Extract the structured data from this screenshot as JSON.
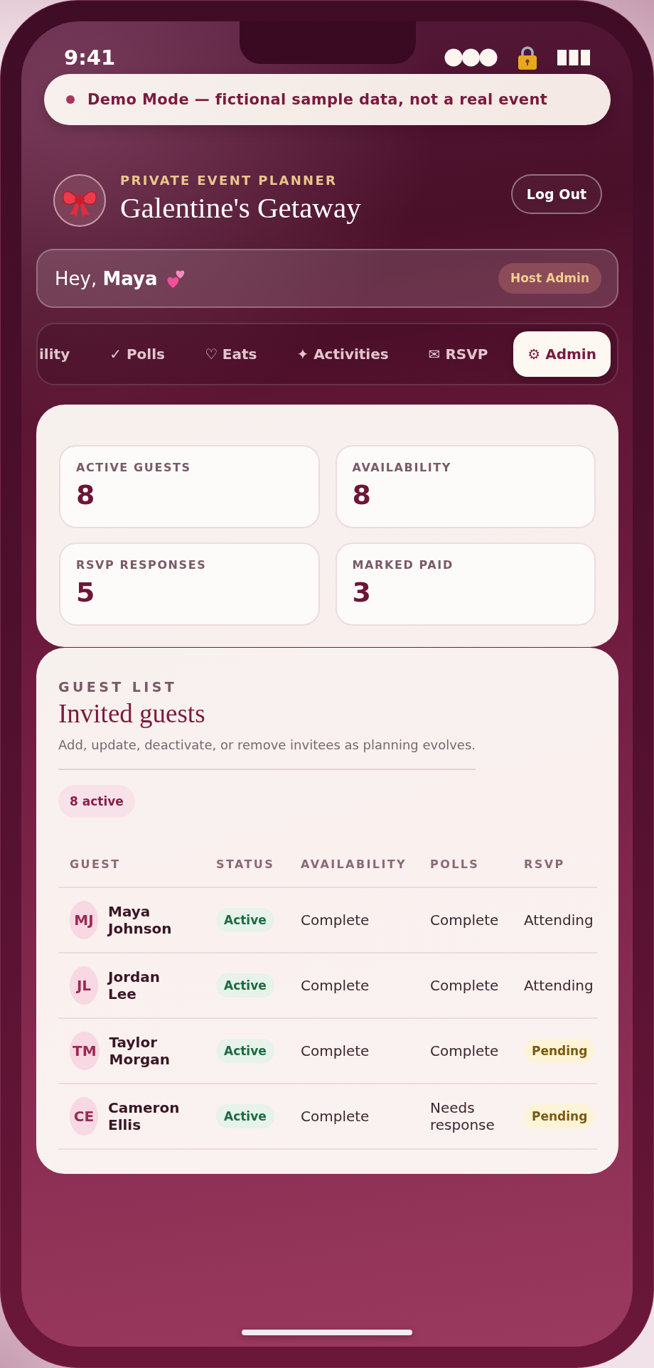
{
  "status_bar": {
    "time": "9:41"
  },
  "demo_banner": {
    "text": "Demo Mode — fictional sample data, not a real event"
  },
  "header": {
    "eyebrow": "PRIVATE EVENT PLANNER",
    "title": "Galentine's Getaway",
    "logout_button": "Log Out"
  },
  "greeting": {
    "text": "Hey, **Maya**",
    "role_badge": "Host Admin"
  },
  "tabs": [
    {
      "label": "ility",
      "selected": false
    },
    {
      "label": "✓ Polls",
      "selected": false
    },
    {
      "label": "♡ Eats",
      "selected": false
    },
    {
      "label": "✦ Activities",
      "selected": false
    },
    {
      "label": "✉ RSVP",
      "selected": false
    },
    {
      "label": "⚙ Admin",
      "selected": true
    }
  ],
  "stats": [
    {
      "label": "ACTIVE GUESTS",
      "value": "8"
    },
    {
      "label": "AVAILABILITY",
      "value": "8"
    },
    {
      "label": "RSVP RESPONSES",
      "value": "5"
    },
    {
      "label": "MARKED PAID",
      "value": "3"
    }
  ],
  "guest_list": {
    "eyebrow": "GUEST LIST",
    "title": "Invited guests",
    "description": "Add, update, deactivate, or remove invitees as planning evolves.",
    "count_badge": "8 active",
    "table": {
      "columns": [
        "GUEST",
        "STATUS",
        "AVAILABILITY",
        "POLLS",
        "RSVP"
      ],
      "rows": [
        {
          "initials": "MJ",
          "name": "Maya Johnson",
          "status": "Active",
          "availability": "Complete",
          "polls": "Complete",
          "rsvp": {
            "label": "Attending",
            "kind": "plain"
          }
        },
        {
          "initials": "JL",
          "name": "Jordan Lee",
          "status": "Active",
          "availability": "Complete",
          "polls": "Complete",
          "rsvp": {
            "label": "Attending",
            "kind": "plain"
          }
        },
        {
          "initials": "TM",
          "name": "Taylor Morgan",
          "status": "Active",
          "availability": "Complete",
          "polls": "Complete",
          "rsvp": {
            "label": "Pending",
            "kind": "pending"
          }
        },
        {
          "initials": "CE",
          "name": "Cameron Ellis",
          "status": "Active",
          "availability": "Complete",
          "polls": "Needs response",
          "rsvp": {
            "label": "Pending",
            "kind": "pending"
          }
        }
      ]
    }
  }
}
